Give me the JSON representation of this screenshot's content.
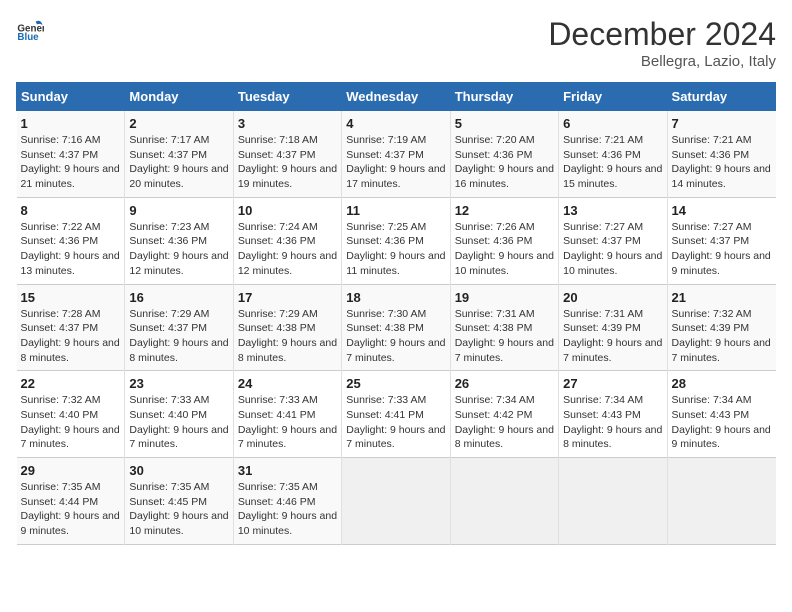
{
  "logo": {
    "general": "General",
    "blue": "Blue"
  },
  "title": "December 2024",
  "subtitle": "Bellegra, Lazio, Italy",
  "days_header": [
    "Sunday",
    "Monday",
    "Tuesday",
    "Wednesday",
    "Thursday",
    "Friday",
    "Saturday"
  ],
  "weeks": [
    [
      {
        "day": "1",
        "info": "Sunrise: 7:16 AM\nSunset: 4:37 PM\nDaylight: 9 hours and 21 minutes."
      },
      {
        "day": "2",
        "info": "Sunrise: 7:17 AM\nSunset: 4:37 PM\nDaylight: 9 hours and 20 minutes."
      },
      {
        "day": "3",
        "info": "Sunrise: 7:18 AM\nSunset: 4:37 PM\nDaylight: 9 hours and 19 minutes."
      },
      {
        "day": "4",
        "info": "Sunrise: 7:19 AM\nSunset: 4:37 PM\nDaylight: 9 hours and 17 minutes."
      },
      {
        "day": "5",
        "info": "Sunrise: 7:20 AM\nSunset: 4:36 PM\nDaylight: 9 hours and 16 minutes."
      },
      {
        "day": "6",
        "info": "Sunrise: 7:21 AM\nSunset: 4:36 PM\nDaylight: 9 hours and 15 minutes."
      },
      {
        "day": "7",
        "info": "Sunrise: 7:21 AM\nSunset: 4:36 PM\nDaylight: 9 hours and 14 minutes."
      }
    ],
    [
      {
        "day": "8",
        "info": "Sunrise: 7:22 AM\nSunset: 4:36 PM\nDaylight: 9 hours and 13 minutes."
      },
      {
        "day": "9",
        "info": "Sunrise: 7:23 AM\nSunset: 4:36 PM\nDaylight: 9 hours and 12 minutes."
      },
      {
        "day": "10",
        "info": "Sunrise: 7:24 AM\nSunset: 4:36 PM\nDaylight: 9 hours and 12 minutes."
      },
      {
        "day": "11",
        "info": "Sunrise: 7:25 AM\nSunset: 4:36 PM\nDaylight: 9 hours and 11 minutes."
      },
      {
        "day": "12",
        "info": "Sunrise: 7:26 AM\nSunset: 4:36 PM\nDaylight: 9 hours and 10 minutes."
      },
      {
        "day": "13",
        "info": "Sunrise: 7:27 AM\nSunset: 4:37 PM\nDaylight: 9 hours and 10 minutes."
      },
      {
        "day": "14",
        "info": "Sunrise: 7:27 AM\nSunset: 4:37 PM\nDaylight: 9 hours and 9 minutes."
      }
    ],
    [
      {
        "day": "15",
        "info": "Sunrise: 7:28 AM\nSunset: 4:37 PM\nDaylight: 9 hours and 8 minutes."
      },
      {
        "day": "16",
        "info": "Sunrise: 7:29 AM\nSunset: 4:37 PM\nDaylight: 9 hours and 8 minutes."
      },
      {
        "day": "17",
        "info": "Sunrise: 7:29 AM\nSunset: 4:38 PM\nDaylight: 9 hours and 8 minutes."
      },
      {
        "day": "18",
        "info": "Sunrise: 7:30 AM\nSunset: 4:38 PM\nDaylight: 9 hours and 7 minutes."
      },
      {
        "day": "19",
        "info": "Sunrise: 7:31 AM\nSunset: 4:38 PM\nDaylight: 9 hours and 7 minutes."
      },
      {
        "day": "20",
        "info": "Sunrise: 7:31 AM\nSunset: 4:39 PM\nDaylight: 9 hours and 7 minutes."
      },
      {
        "day": "21",
        "info": "Sunrise: 7:32 AM\nSunset: 4:39 PM\nDaylight: 9 hours and 7 minutes."
      }
    ],
    [
      {
        "day": "22",
        "info": "Sunrise: 7:32 AM\nSunset: 4:40 PM\nDaylight: 9 hours and 7 minutes."
      },
      {
        "day": "23",
        "info": "Sunrise: 7:33 AM\nSunset: 4:40 PM\nDaylight: 9 hours and 7 minutes."
      },
      {
        "day": "24",
        "info": "Sunrise: 7:33 AM\nSunset: 4:41 PM\nDaylight: 9 hours and 7 minutes."
      },
      {
        "day": "25",
        "info": "Sunrise: 7:33 AM\nSunset: 4:41 PM\nDaylight: 9 hours and 7 minutes."
      },
      {
        "day": "26",
        "info": "Sunrise: 7:34 AM\nSunset: 4:42 PM\nDaylight: 9 hours and 8 minutes."
      },
      {
        "day": "27",
        "info": "Sunrise: 7:34 AM\nSunset: 4:43 PM\nDaylight: 9 hours and 8 minutes."
      },
      {
        "day": "28",
        "info": "Sunrise: 7:34 AM\nSunset: 4:43 PM\nDaylight: 9 hours and 9 minutes."
      }
    ],
    [
      {
        "day": "29",
        "info": "Sunrise: 7:35 AM\nSunset: 4:44 PM\nDaylight: 9 hours and 9 minutes."
      },
      {
        "day": "30",
        "info": "Sunrise: 7:35 AM\nSunset: 4:45 PM\nDaylight: 9 hours and 10 minutes."
      },
      {
        "day": "31",
        "info": "Sunrise: 7:35 AM\nSunset: 4:46 PM\nDaylight: 9 hours and 10 minutes."
      },
      null,
      null,
      null,
      null
    ]
  ]
}
